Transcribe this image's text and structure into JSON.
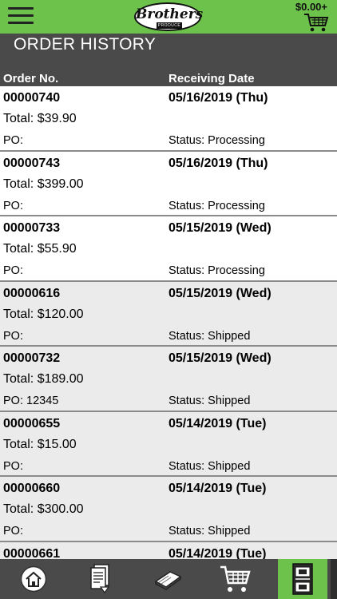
{
  "header": {
    "cart_total": "$0.00+",
    "logo_word": "Brothers",
    "logo_sub": "PRODUCE"
  },
  "page": {
    "title": "ORDER HISTORY",
    "col_order": "Order No.",
    "col_date": "Receiving Date"
  },
  "orders": [
    {
      "no": "00000740",
      "date": "05/16/2019 (Thu)",
      "total": "Total: $39.90",
      "po": "PO:",
      "status": "Status: Processing"
    },
    {
      "no": "00000743",
      "date": "05/16/2019 (Thu)",
      "total": "Total: $399.00",
      "po": "PO:",
      "status": "Status: Processing"
    },
    {
      "no": "00000733",
      "date": "05/15/2019 (Wed)",
      "total": "Total: $55.90",
      "po": "PO:",
      "status": "Status: Processing"
    },
    {
      "no": "00000616",
      "date": "05/15/2019 (Wed)",
      "total": "Total: $120.00",
      "po": "PO:",
      "status": "Status: Shipped"
    },
    {
      "no": "00000732",
      "date": "05/15/2019 (Wed)",
      "total": "Total: $189.00",
      "po": "PO: 12345",
      "status": "Status: Shipped"
    },
    {
      "no": "00000655",
      "date": "05/14/2019 (Tue)",
      "total": "Total: $15.00",
      "po": "PO:",
      "status": "Status: Shipped"
    },
    {
      "no": "00000660",
      "date": "05/14/2019 (Tue)",
      "total": "Total: $300.00",
      "po": "PO:",
      "status": "Status: Shipped"
    },
    {
      "no": "00000661",
      "date": "05/14/2019 (Tue)",
      "total": "",
      "po": "",
      "status": ""
    }
  ],
  "nav": {
    "items": [
      {
        "icon": "home-icon"
      },
      {
        "icon": "order-list-icon"
      },
      {
        "icon": "catalog-book-icon"
      },
      {
        "icon": "cart-icon"
      },
      {
        "icon": "order-history-icon",
        "active": true
      }
    ]
  },
  "colors": {
    "brand_green": "#6cc24a",
    "header_gray": "#4a4a4a",
    "row_gray": "#ebebeb"
  }
}
